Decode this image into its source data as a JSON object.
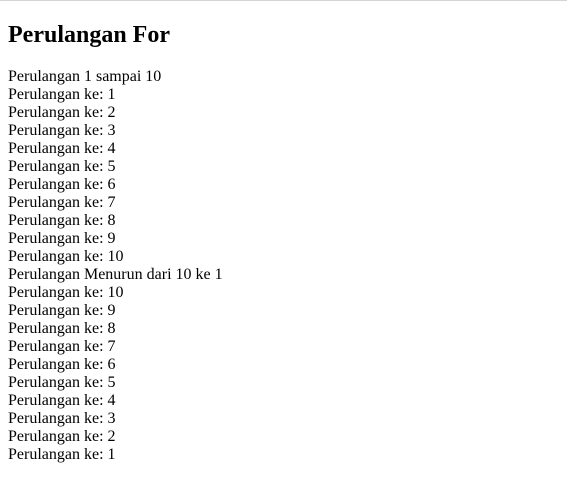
{
  "page": {
    "title": "Perulangan For"
  },
  "output": {
    "lines": [
      "Perulangan 1 sampai 10",
      "Perulangan ke: 1",
      "Perulangan ke: 2",
      "Perulangan ke: 3",
      "Perulangan ke: 4",
      "Perulangan ke: 5",
      "Perulangan ke: 6",
      "Perulangan ke: 7",
      "Perulangan ke: 8",
      "Perulangan ke: 9",
      "Perulangan ke: 10",
      "Perulangan Menurun dari 10 ke 1",
      "Perulangan ke: 10",
      "Perulangan ke: 9",
      "Perulangan ke: 8",
      "Perulangan ke: 7",
      "Perulangan ke: 6",
      "Perulangan ke: 5",
      "Perulangan ke: 4",
      "Perulangan ke: 3",
      "Perulangan ke: 2",
      "Perulangan ke: 1"
    ]
  }
}
